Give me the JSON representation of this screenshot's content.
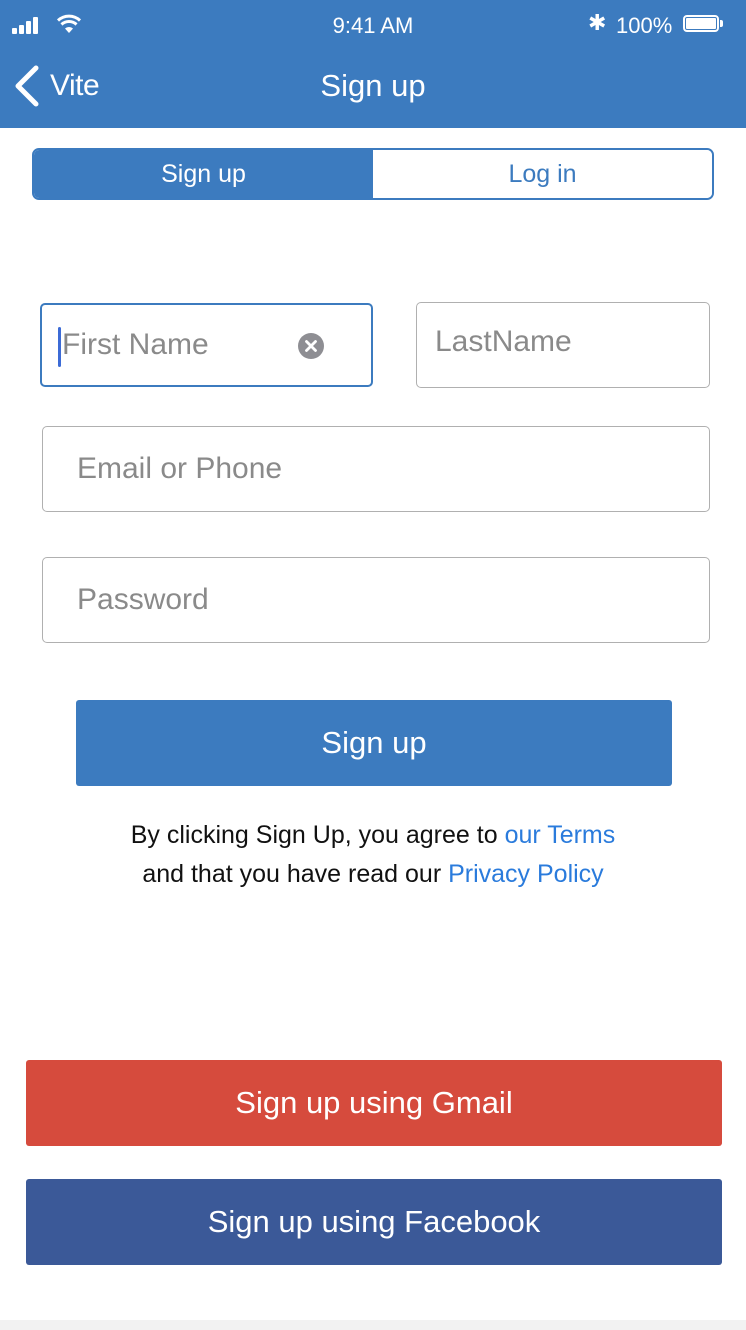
{
  "status_bar": {
    "time": "9:41 AM",
    "battery_percent": "100%",
    "bluetooth_symbol": "✱",
    "icons": [
      "signal-icon",
      "wifi-icon",
      "bluetooth-icon",
      "battery-icon"
    ]
  },
  "nav": {
    "back_label": "Vite",
    "title": "Sign up"
  },
  "segments": [
    {
      "label": "Sign up",
      "selected": true
    },
    {
      "label": "Log in",
      "selected": false
    }
  ],
  "form": {
    "first_name": {
      "placeholder": "First Name",
      "value": ""
    },
    "last_name": {
      "placeholder": "LastName",
      "value": ""
    },
    "email_or_phone": {
      "placeholder": "Email or Phone",
      "value": ""
    },
    "password": {
      "placeholder": "Password",
      "value": ""
    },
    "submit_label": "Sign up"
  },
  "terms": {
    "line1_text": "By clicking Sign Up, you agree to ",
    "terms_link": "our Terms",
    "line2_text": "and that you have read our ",
    "privacy_link": "Privacy Policy"
  },
  "social": {
    "gmail_label": "Sign up using Gmail",
    "facebook_label": "Sign up using Facebook"
  },
  "colors": {
    "primary": "#3c7bbf",
    "gmail": "#d64b3d",
    "facebook": "#3b5998",
    "link": "#2a7bdc"
  }
}
